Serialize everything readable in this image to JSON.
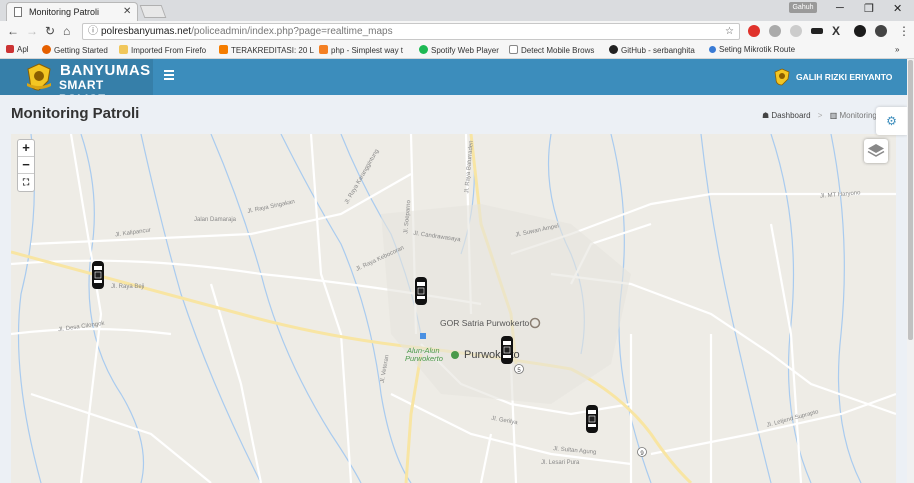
{
  "browser": {
    "tab_title": "Monitoring Patroli",
    "url_host": "polresbanyumas.net",
    "url_path": "/policeadmin/index.php?page=realtime_maps",
    "profile_badge": "Gahuh",
    "bookmarks": [
      "Apl",
      "Getting Started",
      "Imported From Firefo",
      "TERAKREDITASI: 20 L",
      "php - Simplest way t",
      "Spotify Web Player",
      "Detect Mobile Brows",
      "GitHub - serbanghita",
      "Seting Mikrotik Route"
    ],
    "overflow": "»"
  },
  "header": {
    "brand_line1": "BANYUMAS",
    "brand_line2": "SMART POLICE",
    "user_name": "GALIH RIZKI ERIYANTO"
  },
  "page": {
    "title": "Monitoring Patroli",
    "breadcrumb": [
      "Dashboard",
      "Monitoring P"
    ]
  },
  "map": {
    "zoom_in": "+",
    "zoom_out": "−",
    "fullscreen": "⛶",
    "labels": {
      "gor": "GOR Satria Purwokerto",
      "alun1": "Alun-Alun",
      "alun2": "Purwokerto",
      "city": "Purwokerto",
      "jl_kaliwangi": "Jalan Damaraja",
      "jl_raya_singakan": "Jl. Raya Singakan",
      "jl_candrawasaya": "Jl. Candrawasaya",
      "jl_suwan": "Jl. Suwan Ampel",
      "jl_mt_haryono": "Jl. MT Haryono",
      "jl_gerilya": "Jl. Gerilya",
      "jl_sultan": "Jl. Sultan Agung",
      "jl_lesari": "Jl. Lesari Pura",
      "jl_letjend": "Jl. Letjend Suprapto",
      "jl_kalipancur": "Jl. Kalipancur",
      "jl_desa": "Jl. Desa Cilongok",
      "jl_raya_kebocoran": "Jl. Raya Kebocoran",
      "jl_karanggintung": "Jl. Raya Karanggintung",
      "jl_veteran": "Jl. Veteran",
      "jl_soeparno": "Jl. Soeparno",
      "jl_raya_beji": "Jl. Raya Beji",
      "jl_raya_baturaden": "Jl. Raya Baturraden"
    },
    "route_badges": [
      "5",
      "9"
    ],
    "vehicle_count": 4
  },
  "colors": {
    "header_blue": "#3c8dbc",
    "brand_blue": "#367fa9",
    "map_land": "#eeece6",
    "road_major": "#f8e5a3",
    "road_minor": "#ffffff",
    "water": "#a9cbef"
  }
}
